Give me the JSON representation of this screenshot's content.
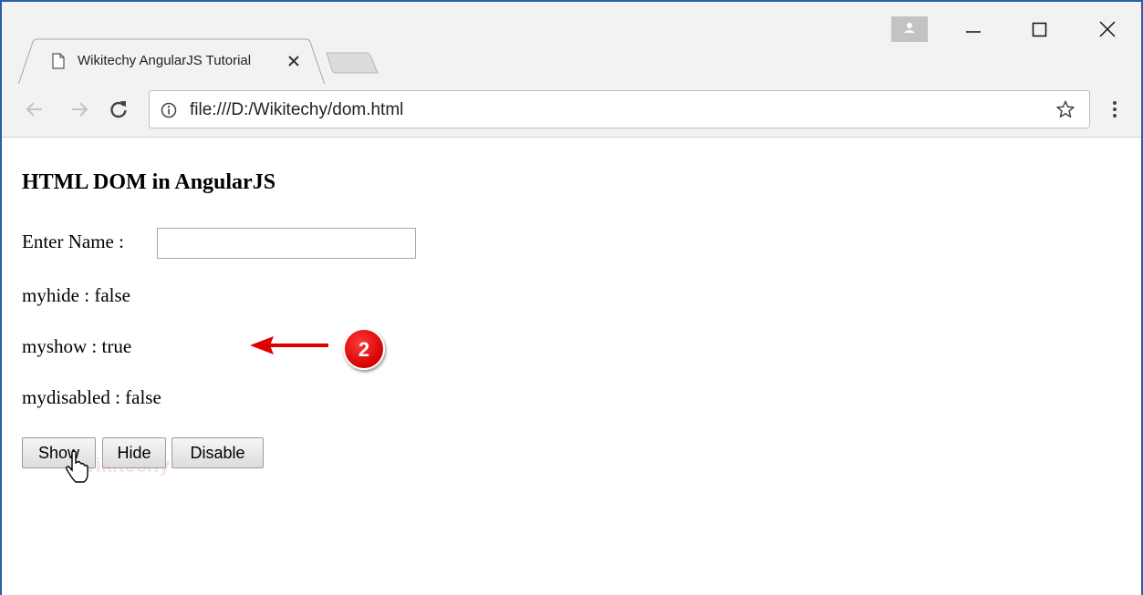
{
  "browser": {
    "tab_title": "Wikitechy AngularJS Tutorial",
    "url": "file:///D:/Wikitechy/dom.html"
  },
  "page": {
    "heading": "HTML DOM in AngularJS",
    "name_label": "Enter Name :",
    "name_value": "",
    "myhide_text": "myhide : false",
    "myshow_text": "myshow : true",
    "mydisabled_text": "mydisabled : false",
    "buttons": {
      "show": "Show",
      "hide": "Hide",
      "disable": "Disable"
    },
    "watermark": "Wikitechy"
  },
  "annotation": {
    "callout_number": "2",
    "color": "#e00000"
  },
  "icons": [
    "page-icon",
    "close-icon",
    "profile-icon",
    "minimize-icon",
    "maximize-icon",
    "close-window-icon",
    "back-icon",
    "forward-icon",
    "reload-icon",
    "info-icon",
    "star-icon",
    "menu-icon",
    "cursor-icon",
    "arrow-icon"
  ]
}
